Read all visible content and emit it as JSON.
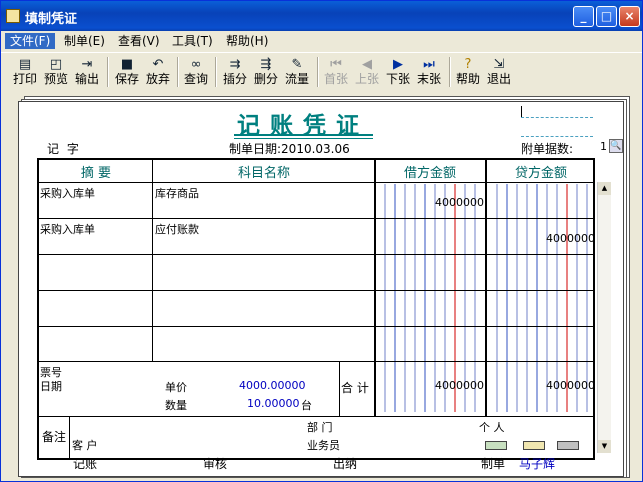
{
  "window": {
    "title": "填制凭证"
  },
  "menu": [
    {
      "label": "文件(F)",
      "active": true
    },
    {
      "label": "制单(E)",
      "active": false
    },
    {
      "label": "查看(V)",
      "active": false
    },
    {
      "label": "工具(T)",
      "active": false
    },
    {
      "label": "帮助(H)",
      "active": false
    }
  ],
  "toolbar": [
    {
      "label": "打印",
      "icon": "print-icon"
    },
    {
      "label": "预览",
      "icon": "preview-icon"
    },
    {
      "label": "输出",
      "icon": "output-icon"
    },
    {
      "label": "保存",
      "icon": "save-icon"
    },
    {
      "label": "放弃",
      "icon": "undo-icon"
    },
    {
      "label": "查询",
      "icon": "binoculars-icon"
    },
    {
      "label": "插分",
      "icon": "insert-row-icon"
    },
    {
      "label": "删分",
      "icon": "delete-row-icon"
    },
    {
      "label": "流量",
      "icon": "cashflow-icon"
    },
    {
      "label": "首张",
      "icon": "first-icon",
      "disabled": true
    },
    {
      "label": "上张",
      "icon": "prev-icon",
      "disabled": true
    },
    {
      "label": "下张",
      "icon": "next-icon"
    },
    {
      "label": "末张",
      "icon": "last-icon"
    },
    {
      "label": "帮助",
      "icon": "help-icon"
    },
    {
      "label": "退出",
      "icon": "exit-icon"
    }
  ],
  "voucher": {
    "title": "记账凭证",
    "word_label": "记 字",
    "date_label": "制单日期:2010.03.06",
    "attach_label": "附单据数:",
    "attach_value": "1",
    "headers": {
      "summary": "摘 要",
      "account": "科目名称",
      "debit": "借方金额",
      "credit": "贷方金额"
    },
    "rows": [
      {
        "summary": "采购入库单",
        "account": "库存商品",
        "debit": "4000000",
        "credit": ""
      },
      {
        "summary": "采购入库单",
        "account": "应付账款",
        "debit": "",
        "credit": "4000000"
      },
      {
        "summary": "",
        "account": "",
        "debit": "",
        "credit": ""
      },
      {
        "summary": "",
        "account": "",
        "debit": "",
        "credit": ""
      },
      {
        "summary": "",
        "account": "",
        "debit": "",
        "credit": ""
      }
    ],
    "footer": {
      "ticket_label": "票号",
      "date_label": "日期",
      "price_label": "单价",
      "price_value": "4000.00000",
      "qty_label": "数量",
      "qty_value": "10.00000",
      "qty_unit": "台",
      "total_label": "合 计",
      "total_debit": "4000000",
      "total_credit": "4000000"
    },
    "notes": {
      "label": "备注",
      "dept_label": "部  门",
      "person_label": "个  人",
      "customer_label": "客  户",
      "salesman_label": "业务员"
    },
    "signatures": {
      "bookkeeper": "记账",
      "reviewer": "审核",
      "cashier": "出纳",
      "maker_label": "制单",
      "maker_name": "马子辉"
    }
  }
}
